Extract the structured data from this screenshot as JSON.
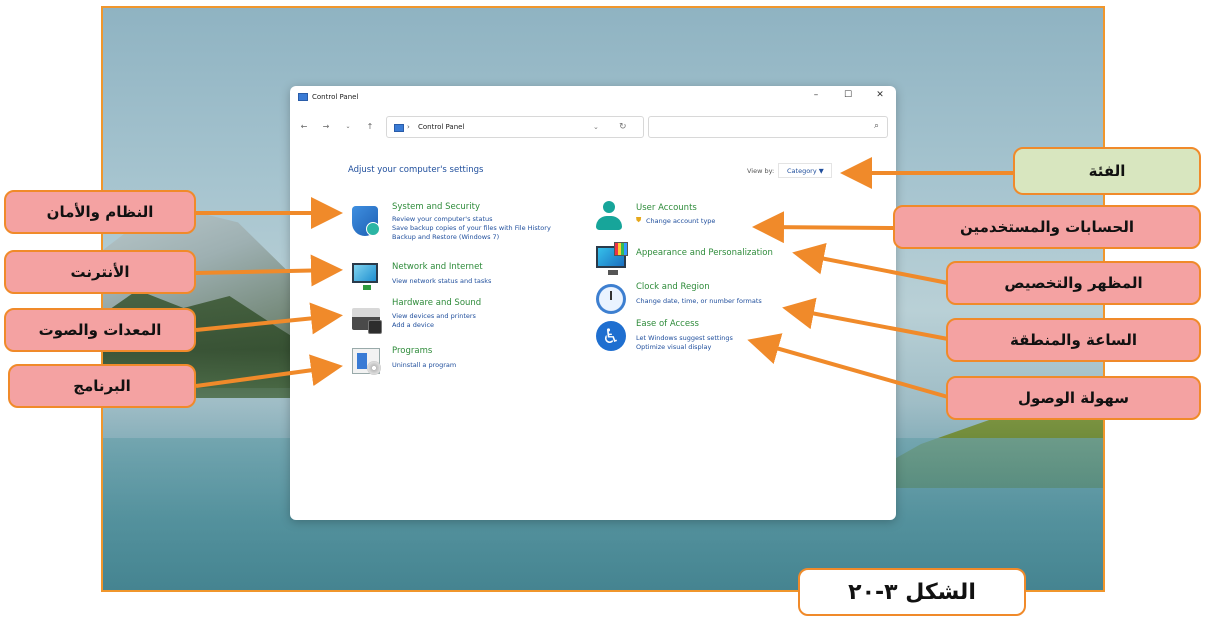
{
  "window": {
    "title": "Control Panel",
    "controls": {
      "minimize": "–",
      "maximize": "☐",
      "close": "✕"
    }
  },
  "navigation": {
    "back": "←",
    "forward": "→",
    "recent": "⌄",
    "up": "↑",
    "address_separator": "›",
    "address_text": "Control Panel",
    "address_dropdown": "⌄",
    "refresh": "↻",
    "search_placeholder": "",
    "search_glyph": "⌕"
  },
  "main": {
    "heading": "Adjust your computer's settings",
    "view_by_label": "View by:",
    "view_by_value": "Category ▼"
  },
  "categories_left": [
    {
      "title": "System and Security",
      "icon": "shield-icon",
      "links": [
        "Review your computer's status",
        "Save backup copies of your files with File History",
        "Backup and Restore (Windows 7)"
      ]
    },
    {
      "title": "Network and Internet",
      "icon": "network-icon",
      "links": [
        "View network status and tasks"
      ]
    },
    {
      "title": "Hardware and Sound",
      "icon": "printer-icon",
      "links": [
        "View devices and printers",
        "Add a device"
      ]
    },
    {
      "title": "Programs",
      "icon": "programs-icon",
      "links": [
        "Uninstall a program"
      ]
    }
  ],
  "categories_right": [
    {
      "title": "User Accounts",
      "icon": "user-icon",
      "links": [
        "Change account type"
      ]
    },
    {
      "title": "Appearance and Personalization",
      "icon": "appearance-icon",
      "links": []
    },
    {
      "title": "Clock and Region",
      "icon": "clock-icon",
      "links": [
        "Change date, time, or number formats"
      ]
    },
    {
      "title": "Ease of Access",
      "icon": "ease-of-access-icon",
      "links": [
        "Let Windows suggest settings",
        "Optimize visual display"
      ]
    }
  ],
  "callouts": {
    "category": "الفئة",
    "system_security": "النظام والأمان",
    "internet": "الأنترنت",
    "hardware_sound": "المعدات والصوت",
    "programs": "البرنامج",
    "user_accounts": "الحسابات والمستخدمين",
    "appearance": "المظهر والتخصيص",
    "clock_region": "الساعة والمنطقة",
    "ease_access": "سهولة الوصول"
  },
  "figure_caption": "الشكل ٣-٢٠",
  "colors": {
    "callout_fill": "#f4a2a2",
    "callout_category_fill": "#d8e6bf",
    "accent_orange": "#f08a2a",
    "link_blue": "#1f4e9c",
    "title_green": "#2e8b3a"
  }
}
